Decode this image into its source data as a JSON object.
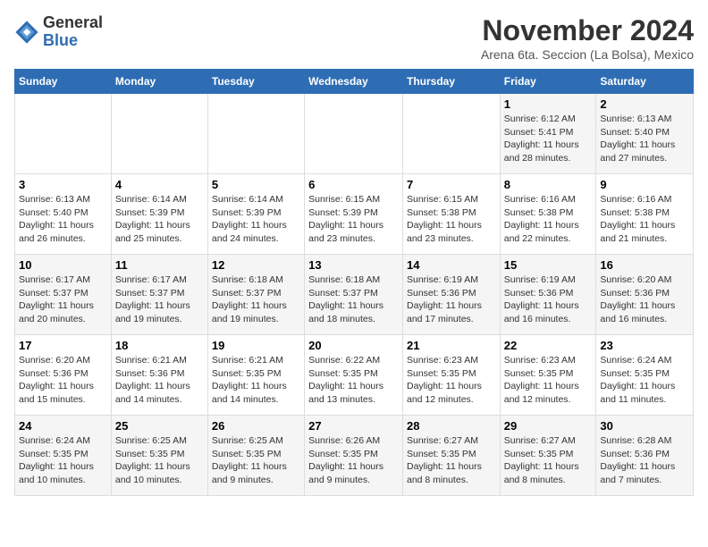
{
  "logo": {
    "general": "General",
    "blue": "Blue"
  },
  "title": "November 2024",
  "location": "Arena 6ta. Seccion (La Bolsa), Mexico",
  "days_of_week": [
    "Sunday",
    "Monday",
    "Tuesday",
    "Wednesday",
    "Thursday",
    "Friday",
    "Saturday"
  ],
  "weeks": [
    [
      null,
      null,
      null,
      null,
      null,
      {
        "day": 1,
        "sunrise": "6:12 AM",
        "sunset": "5:41 PM",
        "daylight": "11 hours and 28 minutes."
      },
      {
        "day": 2,
        "sunrise": "6:13 AM",
        "sunset": "5:40 PM",
        "daylight": "11 hours and 27 minutes."
      }
    ],
    [
      {
        "day": 3,
        "sunrise": "6:13 AM",
        "sunset": "5:40 PM",
        "daylight": "11 hours and 26 minutes."
      },
      {
        "day": 4,
        "sunrise": "6:14 AM",
        "sunset": "5:39 PM",
        "daylight": "11 hours and 25 minutes."
      },
      {
        "day": 5,
        "sunrise": "6:14 AM",
        "sunset": "5:39 PM",
        "daylight": "11 hours and 24 minutes."
      },
      {
        "day": 6,
        "sunrise": "6:15 AM",
        "sunset": "5:39 PM",
        "daylight": "11 hours and 23 minutes."
      },
      {
        "day": 7,
        "sunrise": "6:15 AM",
        "sunset": "5:38 PM",
        "daylight": "11 hours and 23 minutes."
      },
      {
        "day": 8,
        "sunrise": "6:16 AM",
        "sunset": "5:38 PM",
        "daylight": "11 hours and 22 minutes."
      },
      {
        "day": 9,
        "sunrise": "6:16 AM",
        "sunset": "5:38 PM",
        "daylight": "11 hours and 21 minutes."
      }
    ],
    [
      {
        "day": 10,
        "sunrise": "6:17 AM",
        "sunset": "5:37 PM",
        "daylight": "11 hours and 20 minutes."
      },
      {
        "day": 11,
        "sunrise": "6:17 AM",
        "sunset": "5:37 PM",
        "daylight": "11 hours and 19 minutes."
      },
      {
        "day": 12,
        "sunrise": "6:18 AM",
        "sunset": "5:37 PM",
        "daylight": "11 hours and 19 minutes."
      },
      {
        "day": 13,
        "sunrise": "6:18 AM",
        "sunset": "5:37 PM",
        "daylight": "11 hours and 18 minutes."
      },
      {
        "day": 14,
        "sunrise": "6:19 AM",
        "sunset": "5:36 PM",
        "daylight": "11 hours and 17 minutes."
      },
      {
        "day": 15,
        "sunrise": "6:19 AM",
        "sunset": "5:36 PM",
        "daylight": "11 hours and 16 minutes."
      },
      {
        "day": 16,
        "sunrise": "6:20 AM",
        "sunset": "5:36 PM",
        "daylight": "11 hours and 16 minutes."
      }
    ],
    [
      {
        "day": 17,
        "sunrise": "6:20 AM",
        "sunset": "5:36 PM",
        "daylight": "11 hours and 15 minutes."
      },
      {
        "day": 18,
        "sunrise": "6:21 AM",
        "sunset": "5:36 PM",
        "daylight": "11 hours and 14 minutes."
      },
      {
        "day": 19,
        "sunrise": "6:21 AM",
        "sunset": "5:35 PM",
        "daylight": "11 hours and 14 minutes."
      },
      {
        "day": 20,
        "sunrise": "6:22 AM",
        "sunset": "5:35 PM",
        "daylight": "11 hours and 13 minutes."
      },
      {
        "day": 21,
        "sunrise": "6:23 AM",
        "sunset": "5:35 PM",
        "daylight": "11 hours and 12 minutes."
      },
      {
        "day": 22,
        "sunrise": "6:23 AM",
        "sunset": "5:35 PM",
        "daylight": "11 hours and 12 minutes."
      },
      {
        "day": 23,
        "sunrise": "6:24 AM",
        "sunset": "5:35 PM",
        "daylight": "11 hours and 11 minutes."
      }
    ],
    [
      {
        "day": 24,
        "sunrise": "6:24 AM",
        "sunset": "5:35 PM",
        "daylight": "11 hours and 10 minutes."
      },
      {
        "day": 25,
        "sunrise": "6:25 AM",
        "sunset": "5:35 PM",
        "daylight": "11 hours and 10 minutes."
      },
      {
        "day": 26,
        "sunrise": "6:25 AM",
        "sunset": "5:35 PM",
        "daylight": "11 hours and 9 minutes."
      },
      {
        "day": 27,
        "sunrise": "6:26 AM",
        "sunset": "5:35 PM",
        "daylight": "11 hours and 9 minutes."
      },
      {
        "day": 28,
        "sunrise": "6:27 AM",
        "sunset": "5:35 PM",
        "daylight": "11 hours and 8 minutes."
      },
      {
        "day": 29,
        "sunrise": "6:27 AM",
        "sunset": "5:35 PM",
        "daylight": "11 hours and 8 minutes."
      },
      {
        "day": 30,
        "sunrise": "6:28 AM",
        "sunset": "5:36 PM",
        "daylight": "11 hours and 7 minutes."
      }
    ]
  ]
}
